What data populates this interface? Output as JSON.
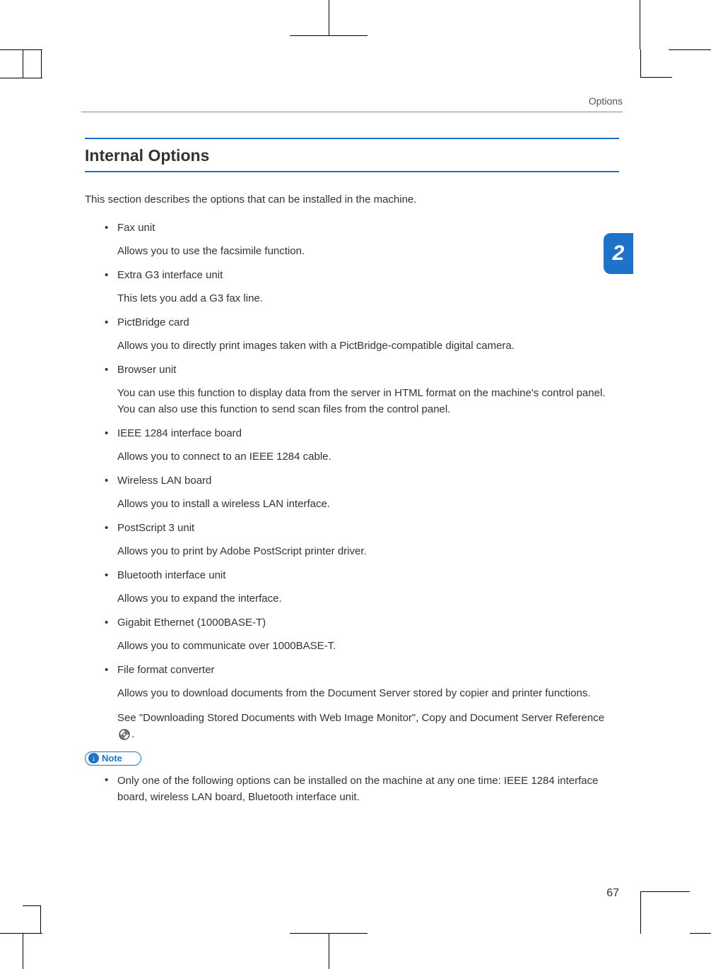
{
  "header": {
    "running": "Options"
  },
  "tab": {
    "num": "2"
  },
  "section": {
    "title": "Internal Options",
    "intro": "This section describes the options that can be installed in the machine."
  },
  "options": [
    {
      "label": "Fax unit",
      "desc": "Allows you to use the facsimile function."
    },
    {
      "label": "Extra G3 interface unit",
      "desc": "This lets you add a G3 fax line."
    },
    {
      "label": "PictBridge card",
      "desc": "Allows you to directly print images taken with a PictBridge-compatible digital camera."
    },
    {
      "label": "Browser unit",
      "desc": "You can use this function to display data from the server in HTML format on the machine's control panel. You can also use this function to send scan files from the control panel."
    },
    {
      "label": "IEEE 1284 interface board",
      "desc": "Allows you to connect to an IEEE 1284 cable."
    },
    {
      "label": "Wireless LAN board",
      "desc": "Allows you to install a wireless LAN interface."
    },
    {
      "label": "PostScript 3 unit",
      "desc": "Allows you to print by Adobe PostScript printer driver."
    },
    {
      "label": "Bluetooth interface unit",
      "desc": "Allows you to expand the interface."
    },
    {
      "label": "Gigabit Ethernet (1000BASE-T)",
      "desc": "Allows you to communicate over 1000BASE-T."
    },
    {
      "label": "File format converter",
      "desc": "Allows you to download documents from the Document Server stored by copier and printer functions.",
      "desc2_pre": "See \"Downloading Stored Documents with Web Image Monitor\", Copy and Document Server Reference",
      "desc2_post": "."
    }
  ],
  "note": {
    "label": "Note",
    "items": [
      "Only one of the following options can be installed on the machine at any one time: IEEE 1284 interface board, wireless LAN board, Bluetooth interface unit."
    ]
  },
  "pageno": "67"
}
